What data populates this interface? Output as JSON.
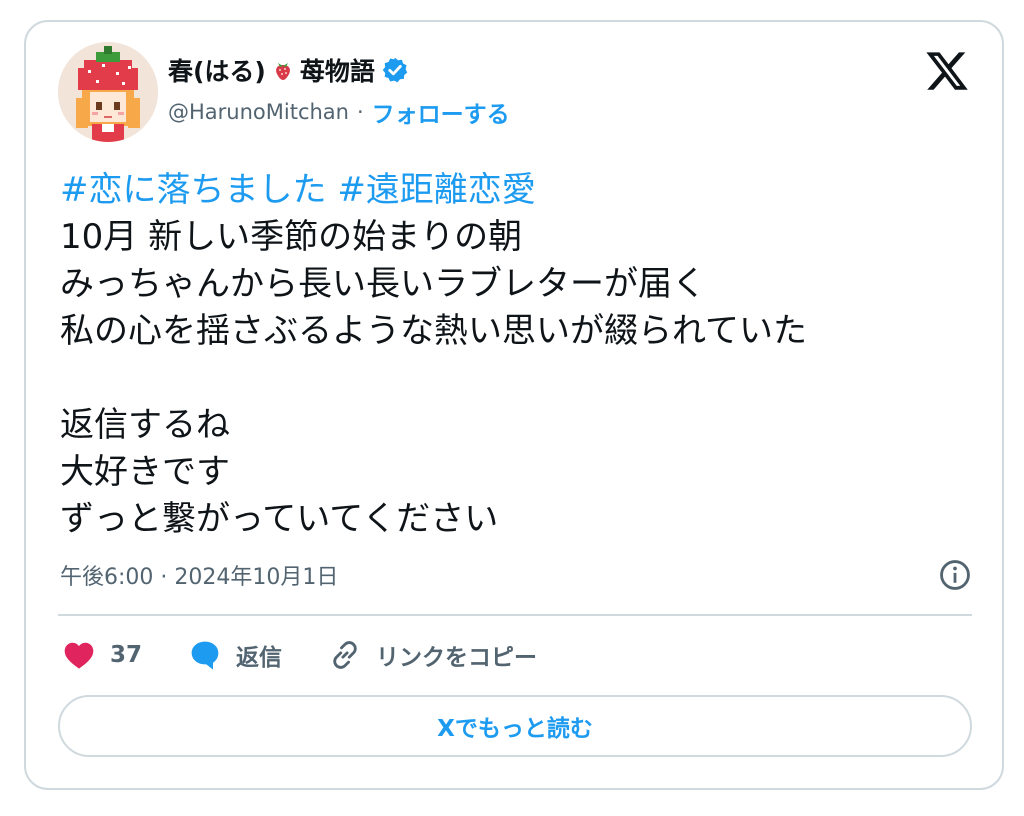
{
  "author": {
    "display_name_part1": "春(はる)",
    "display_name_part2": "苺物語",
    "handle": "@HarunoMitchan",
    "separator": "·",
    "follow_label": "フォローする",
    "strawberry_icon": "strawberry-icon",
    "verified_icon": "verified-badge-icon",
    "avatar": "avatar-pixel-girl-strawberry-hat"
  },
  "brand": {
    "logo": "x-logo-icon"
  },
  "post": {
    "hashtags": [
      "#恋に落ちました",
      "#遠距離恋愛"
    ],
    "lines": [
      "10月 新しい季節の始まりの朝",
      "みっちゃんから長い長いラブレターが届く",
      "私の心を揺さぶるような熱い思いが綴られていた",
      "",
      "返信するね",
      "大好きです",
      "ずっと繋がっていてください"
    ],
    "timestamp": "午後6:00 · 2024年10月1日"
  },
  "actions": {
    "like_count": "37",
    "reply_label": "返信",
    "copy_link_label": "リンクをコピー"
  },
  "read_more_label": "Xでもっと読む",
  "colors": {
    "accent": "#1d9bf0",
    "heart": "#f91880",
    "border": "#cfd9de",
    "secondary_text": "#536471"
  }
}
